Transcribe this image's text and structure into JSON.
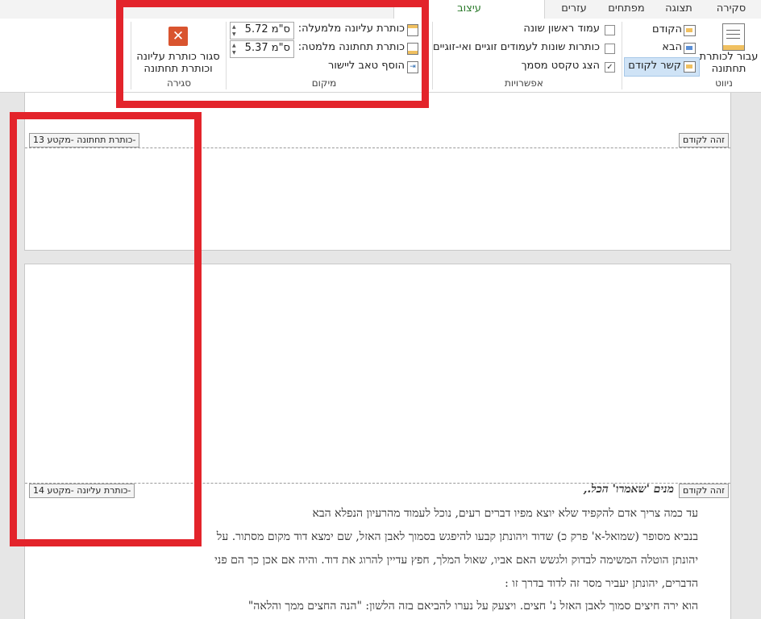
{
  "tabs": [
    "סקירה",
    "תצוגה",
    "מפתחים",
    "עזרים",
    "עיצוב"
  ],
  "ribbon": {
    "navigation": {
      "goto_footer": "עבור לכותרת תחתונה",
      "previous": "הקודם",
      "next": "הבא",
      "link_previous": "קשר לקודם",
      "label": "ניווט"
    },
    "options": {
      "different_first": "עמוד ראשון שונה",
      "different_odd_even": "כותרות שונות לעמודים זוגיים ואי-זוגיים",
      "show_doc_text": "הצג טקסט מסמך",
      "label": "אפשרויות"
    },
    "position": {
      "header_from_top_label": "כותרת עליונה מלמעלה:",
      "header_from_top_value": "5.72 ס\"מ",
      "footer_from_bottom_label": "כותרת תחתונה מלמטה:",
      "footer_from_bottom_value": "5.37 ס\"מ",
      "insert_align_tab": "הוסף טאב ליישור",
      "label": "מיקום"
    },
    "close": {
      "close_label": "סגור כותרת עליונה וכותרת תחתונה",
      "close_line1": "סגור כותרת עליונה",
      "close_line2": "וכותרת תחתונה",
      "label": "סגירה"
    }
  },
  "document": {
    "footer_tag": "-כותרת תחתונה -מקטע 13",
    "header_tag": "-כותרת עליונה -מקטע 14",
    "same_as_previous_1": "זהה לקודם",
    "same_as_previous_2": "זהה לקודם",
    "lines": [
      "מנים 'שאמרו' הכל.,",
      "עד כמה צריך אדם להקפיד שלא יוצא מפיו דברים רעים, נוכל לעמוד מהרעיון הנפלא הבא",
      "בנביא מסופר (שמואל-א' פרק כ) שדוד ויהונתן קבעו להיפגש בסמוך לאבן האזל, שם ימצא דוד מקום מסתור. על",
      "יהונתן הוטלה המשימה לבדוק ולגשש האם אביו, שאול המלך, חפץ עדיין להרוג את דוד. והיה אם אכן כך הם פני",
      "הדברים, יהונתן יעביר מסר זה לדוד בדרך זו :",
      "הוא ירה חיצים סמוך לאבן האזל נ' חצים. ויצעק על נערו להביאם בזה הלשון: \"הנה החצים ממך והלאה\""
    ]
  },
  "colors": {
    "highlight": "#e3242b",
    "active_tab": "#2b7a2b",
    "close_icon": "#d9542f"
  }
}
